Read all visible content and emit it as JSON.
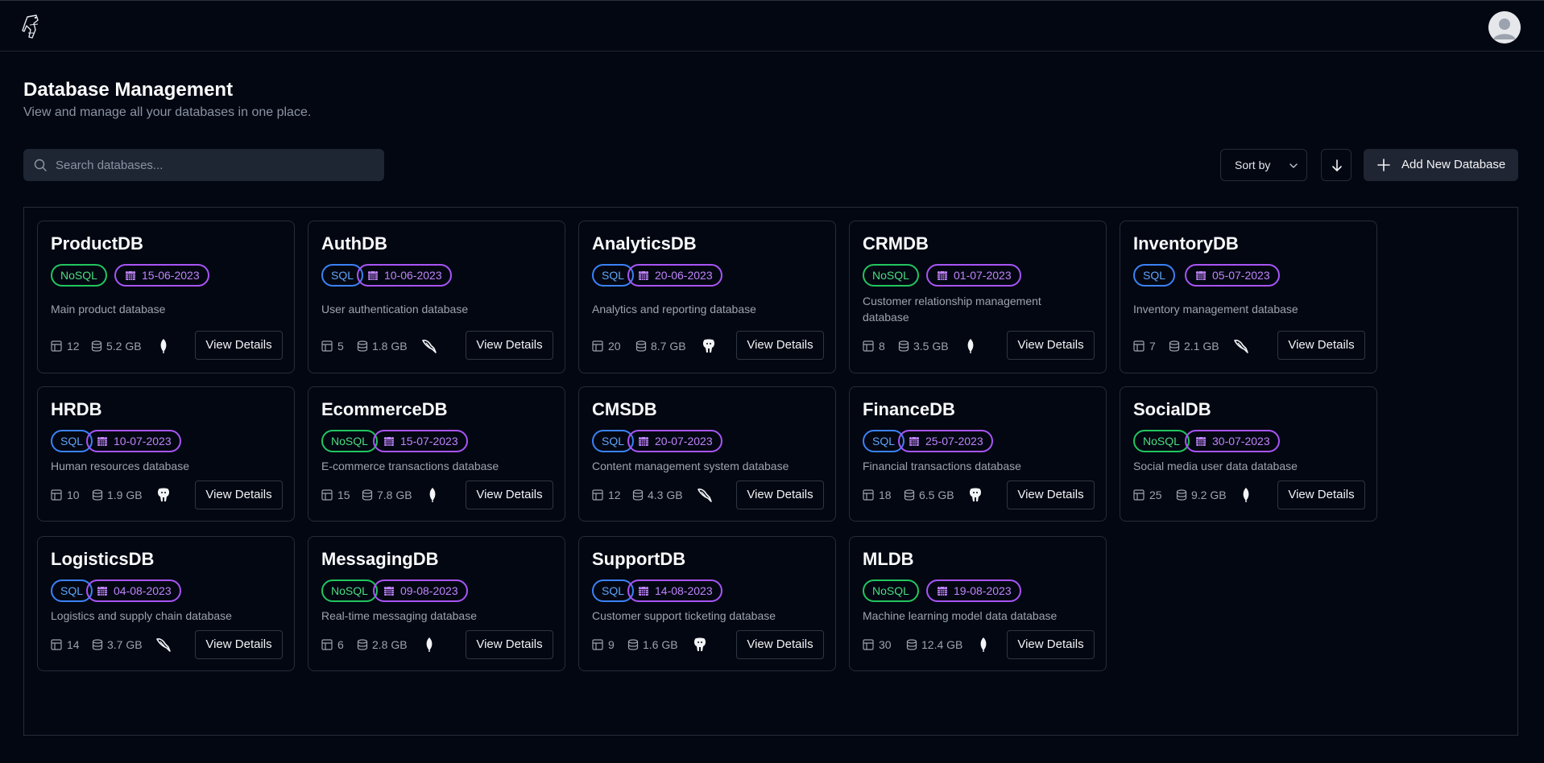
{
  "header": {
    "logo_icon": "flask-logo-icon",
    "avatar_icon": "user-avatar-icon"
  },
  "page": {
    "title": "Database Management",
    "subtitle": "View and manage all your databases in one place."
  },
  "toolbar": {
    "search_placeholder": "Search databases...",
    "sort_label": "Sort by",
    "sort_direction_icon": "arrow-down-icon",
    "add_label": "Add New Database"
  },
  "colors": {
    "background": "#030712",
    "sql": "#3b82f6",
    "nosql": "#22c55e",
    "date": "#a855f7"
  },
  "databases": [
    {
      "name": "ProductDB",
      "type": "NoSQL",
      "date": "15-06-2023",
      "description": "Main product database",
      "tables": "12",
      "size": "5.2 GB",
      "engine": "mongodb-icon",
      "action": "View Details"
    },
    {
      "name": "AuthDB",
      "type": "SQL",
      "date": "10-06-2023",
      "description": "User authentication database",
      "tables": "5",
      "size": "1.8 GB",
      "engine": "mysql-icon",
      "action": "View Details"
    },
    {
      "name": "AnalyticsDB",
      "type": "SQL",
      "date": "20-06-2023",
      "description": "Analytics and reporting database",
      "tables": "20",
      "size": "8.7 GB",
      "engine": "postgresql-icon",
      "action": "View Details"
    },
    {
      "name": "CRMDB",
      "type": "NoSQL",
      "date": "01-07-2023",
      "description": "Customer relationship management database",
      "tables": "8",
      "size": "3.5 GB",
      "engine": "mongodb-icon",
      "action": "View Details"
    },
    {
      "name": "InventoryDB",
      "type": "SQL",
      "date": "05-07-2023",
      "description": "Inventory management database",
      "tables": "7",
      "size": "2.1 GB",
      "engine": "mysql-icon",
      "action": "View Details"
    },
    {
      "name": "HRDB",
      "type": "SQL",
      "date": "10-07-2023",
      "description": "Human resources database",
      "tables": "10",
      "size": "1.9 GB",
      "engine": "postgresql-icon",
      "action": "View Details"
    },
    {
      "name": "EcommerceDB",
      "type": "NoSQL",
      "date": "15-07-2023",
      "description": "E-commerce transactions database",
      "tables": "15",
      "size": "7.8 GB",
      "engine": "mongodb-icon",
      "action": "View Details"
    },
    {
      "name": "CMSDB",
      "type": "SQL",
      "date": "20-07-2023",
      "description": "Content management system database",
      "tables": "12",
      "size": "4.3 GB",
      "engine": "mysql-icon",
      "action": "View Details"
    },
    {
      "name": "FinanceDB",
      "type": "SQL",
      "date": "25-07-2023",
      "description": "Financial transactions database",
      "tables": "18",
      "size": "6.5 GB",
      "engine": "postgresql-icon",
      "action": "View Details"
    },
    {
      "name": "SocialDB",
      "type": "NoSQL",
      "date": "30-07-2023",
      "description": "Social media user data database",
      "tables": "25",
      "size": "9.2 GB",
      "engine": "mongodb-icon",
      "action": "View Details"
    },
    {
      "name": "LogisticsDB",
      "type": "SQL",
      "date": "04-08-2023",
      "description": "Logistics and supply chain database",
      "tables": "14",
      "size": "3.7 GB",
      "engine": "mysql-icon",
      "action": "View Details"
    },
    {
      "name": "MessagingDB",
      "type": "NoSQL",
      "date": "09-08-2023",
      "description": "Real-time messaging database",
      "tables": "6",
      "size": "2.8 GB",
      "engine": "mongodb-icon",
      "action": "View Details"
    },
    {
      "name": "SupportDB",
      "type": "SQL",
      "date": "14-08-2023",
      "description": "Customer support ticketing database",
      "tables": "9",
      "size": "1.6 GB",
      "engine": "postgresql-icon",
      "action": "View Details"
    },
    {
      "name": "MLDB",
      "type": "NoSQL",
      "date": "19-08-2023",
      "description": "Machine learning model data database",
      "tables": "30",
      "size": "12.4 GB",
      "engine": "mongodb-icon",
      "action": "View Details"
    }
  ]
}
